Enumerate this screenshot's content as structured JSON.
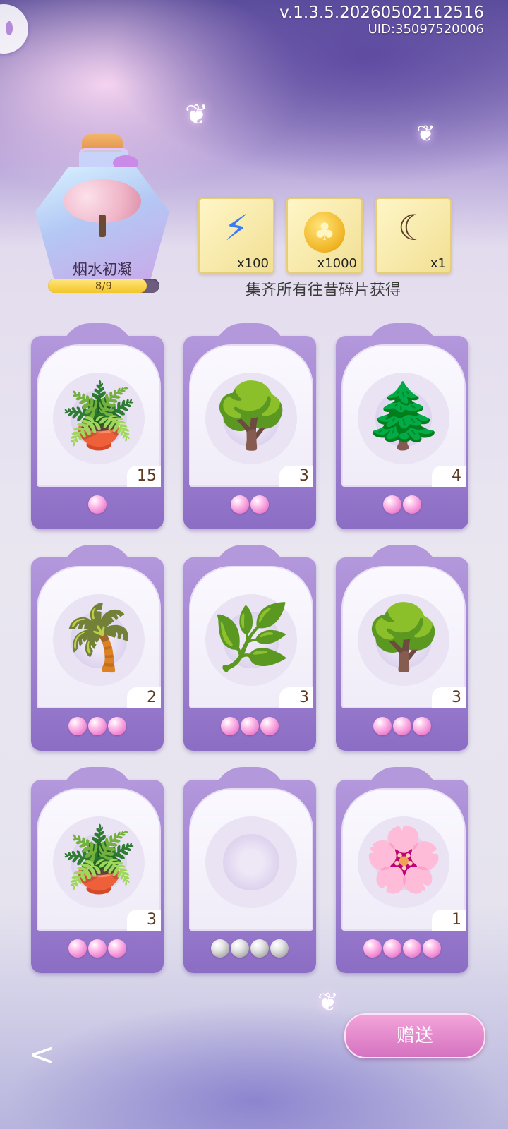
{
  "header": {
    "version": "v.1.3.5.20260502112516",
    "uid": "UID:35097520006"
  },
  "collection": {
    "name": "烟水初凝",
    "progress_text": "8/9",
    "progress_fraction": 0.889
  },
  "rewards": [
    {
      "icon": "lightning-bolt-icon",
      "count": "x100"
    },
    {
      "icon": "clover-coin-icon",
      "count": "x1000"
    },
    {
      "icon": "flower-crescent-ornament-icon",
      "count": "x1"
    }
  ],
  "rewards_caption": "集齐所有往昔碎片获得",
  "cards": [
    {
      "plant": "potted-leafy-plant",
      "count": "15",
      "rarity": 1,
      "owned": true
    },
    {
      "plant": "bonsai-tree",
      "count": "3",
      "rarity": 2,
      "owned": true
    },
    {
      "plant": "topiary-tree",
      "count": "4",
      "rarity": 2,
      "owned": true
    },
    {
      "plant": "potted-palm",
      "count": "2",
      "rarity": 3,
      "owned": true
    },
    {
      "plant": "potted-banana-leaf-plant",
      "count": "3",
      "rarity": 3,
      "owned": true
    },
    {
      "plant": "garden-tree-planter",
      "count": "3",
      "rarity": 3,
      "owned": true
    },
    {
      "plant": "boxwood-planter",
      "count": "3",
      "rarity": 3,
      "owned": true
    },
    {
      "plant": "empty-slot",
      "count": "",
      "rarity": 4,
      "owned": false
    },
    {
      "plant": "cherry-blossom-planter",
      "count": "1",
      "rarity": 4,
      "owned": true
    }
  ],
  "buttons": {
    "send_label": "赠送",
    "back_icon": "chevron-left-icon"
  }
}
